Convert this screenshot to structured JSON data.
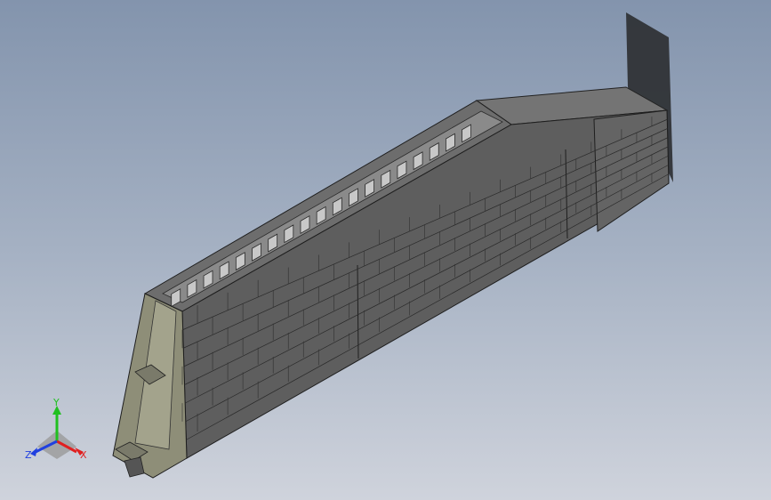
{
  "view": {
    "background_top": "#8394ad",
    "background_bottom": "#cfd3dc"
  },
  "model": {
    "type": "beam-assembly",
    "face_colors": {
      "top": "#6b6b6b",
      "front": "#5a5a5a",
      "end": "#8e8e78",
      "shadow": "#2e3033"
    }
  },
  "triad": {
    "x_label": "X",
    "y_label": "Y",
    "z_label": "Z",
    "x_color": "#e02020",
    "y_color": "#20c020",
    "z_color": "#2040e0"
  }
}
